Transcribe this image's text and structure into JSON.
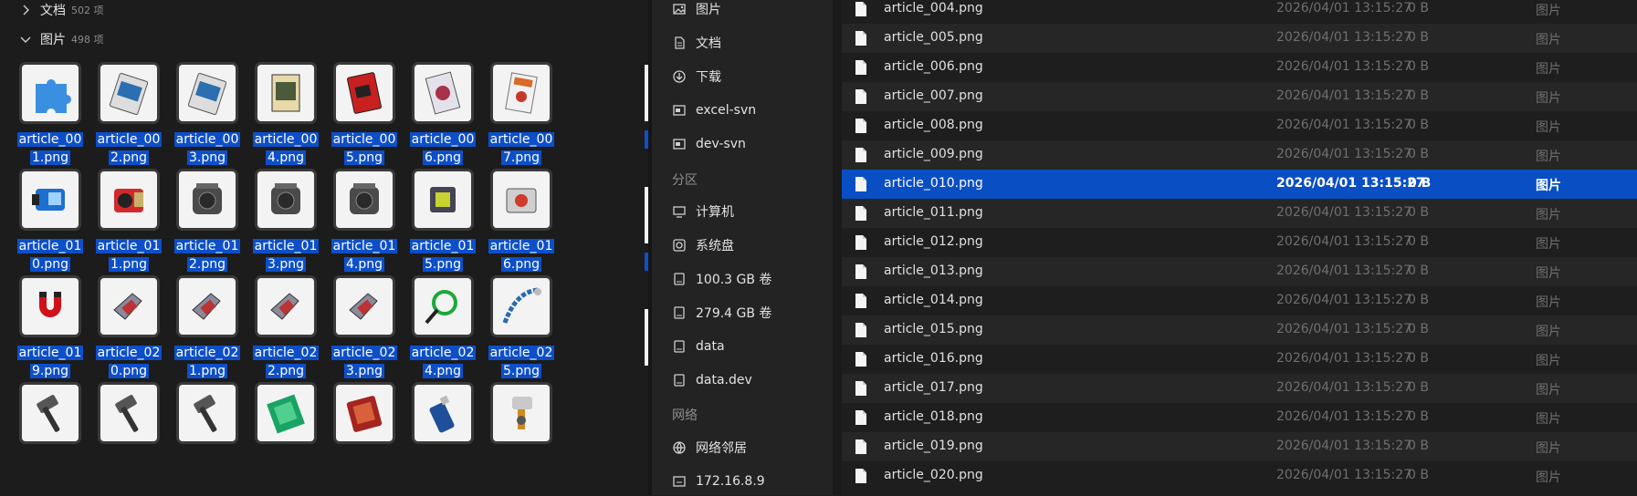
{
  "groups": {
    "documents": {
      "label": "文档",
      "count": "502 项"
    },
    "pictures": {
      "label": "图片",
      "count": "498 项"
    }
  },
  "tiles": [
    {
      "line1": "article_00",
      "line2": "1.png",
      "icon": "puzzle-piece-image-icon"
    },
    {
      "line1": "article_00",
      "line2": "2.png",
      "icon": "card-image-icon"
    },
    {
      "line1": "article_00",
      "line2": "3.png",
      "icon": "card-image-icon"
    },
    {
      "line1": "article_00",
      "line2": "4.png",
      "icon": "book-image-icon"
    },
    {
      "line1": "article_00",
      "line2": "5.png",
      "icon": "red-book-image-icon"
    },
    {
      "line1": "article_00",
      "line2": "6.png",
      "icon": "magazine-image-icon"
    },
    {
      "line1": "article_00",
      "line2": "7.png",
      "icon": "document-image-icon"
    },
    {
      "line1": "article_01",
      "line2": "0.png",
      "icon": "device-image-icon"
    },
    {
      "line1": "article_01",
      "line2": "1.png",
      "icon": "camera-image-icon"
    },
    {
      "line1": "article_01",
      "line2": "2.png",
      "icon": "engine-image-icon"
    },
    {
      "line1": "article_01",
      "line2": "3.png",
      "icon": "engine-image-icon"
    },
    {
      "line1": "article_01",
      "line2": "4.png",
      "icon": "engine-image-icon"
    },
    {
      "line1": "article_01",
      "line2": "5.png",
      "icon": "chip-image-icon"
    },
    {
      "line1": "article_01",
      "line2": "6.png",
      "icon": "machine-image-icon"
    },
    {
      "line1": "article_01",
      "line2": "9.png",
      "icon": "magnet-image-icon"
    },
    {
      "line1": "article_02",
      "line2": "0.png",
      "icon": "clamp-image-icon"
    },
    {
      "line1": "article_02",
      "line2": "1.png",
      "icon": "clamp-image-icon"
    },
    {
      "line1": "article_02",
      "line2": "2.png",
      "icon": "clamp-image-icon"
    },
    {
      "line1": "article_02",
      "line2": "3.png",
      "icon": "clamp-image-icon"
    },
    {
      "line1": "article_02",
      "line2": "4.png",
      "icon": "cable-image-icon"
    },
    {
      "line1": "article_02",
      "line2": "5.png",
      "icon": "chain-image-icon"
    },
    {
      "line1": "",
      "line2": "",
      "icon": "hammer-image-icon"
    },
    {
      "line1": "",
      "line2": "",
      "icon": "hammer-image-icon"
    },
    {
      "line1": "",
      "line2": "",
      "icon": "hammer-image-icon"
    },
    {
      "line1": "",
      "line2": "",
      "icon": "green-board-image-icon"
    },
    {
      "line1": "",
      "line2": "",
      "icon": "red-board-image-icon"
    },
    {
      "line1": "",
      "line2": "",
      "icon": "spray-can-image-icon"
    },
    {
      "line1": "",
      "line2": "",
      "icon": "spray-gun-image-icon"
    }
  ],
  "sidebar": {
    "items_top": [
      {
        "label": "图片",
        "icon": "image-icon"
      },
      {
        "label": "文档",
        "icon": "document-icon"
      },
      {
        "label": "下载",
        "icon": "download-icon"
      },
      {
        "label": "excel-svn",
        "icon": "folder-icon"
      },
      {
        "label": "dev-svn",
        "icon": "folder-icon"
      }
    ],
    "section_partition": "分区",
    "items_partition": [
      {
        "label": "计算机",
        "icon": "computer-icon"
      },
      {
        "label": "系统盘",
        "icon": "system-disk-icon"
      },
      {
        "label": "100.3 GB 卷",
        "icon": "drive-icon"
      },
      {
        "label": "279.4 GB 卷",
        "icon": "drive-icon"
      },
      {
        "label": "data",
        "icon": "drive-icon"
      },
      {
        "label": "data.dev",
        "icon": "drive-icon"
      }
    ],
    "section_network": "网络",
    "items_network": [
      {
        "label": "网络邻居",
        "icon": "network-icon"
      },
      {
        "label": "172.16.8.9",
        "icon": "network-folder-icon"
      }
    ]
  },
  "list": {
    "rows": [
      {
        "name": "article_004.png",
        "date": "2026/04/01 13:15:27",
        "size": "0 B",
        "type": "图片"
      },
      {
        "name": "article_005.png",
        "date": "2026/04/01 13:15:27",
        "size": "0 B",
        "type": "图片"
      },
      {
        "name": "article_006.png",
        "date": "2026/04/01 13:15:27",
        "size": "0 B",
        "type": "图片"
      },
      {
        "name": "article_007.png",
        "date": "2026/04/01 13:15:27",
        "size": "0 B",
        "type": "图片"
      },
      {
        "name": "article_008.png",
        "date": "2026/04/01 13:15:27",
        "size": "0 B",
        "type": "图片"
      },
      {
        "name": "article_009.png",
        "date": "2026/04/01 13:15:27",
        "size": "0 B",
        "type": "图片"
      },
      {
        "name": "article_010.png",
        "date": "2026/04/01 13:15:27",
        "size": "0 B",
        "type": "图片",
        "selected": true
      },
      {
        "name": "article_011.png",
        "date": "2026/04/01 13:15:27",
        "size": "0 B",
        "type": "图片"
      },
      {
        "name": "article_012.png",
        "date": "2026/04/01 13:15:27",
        "size": "0 B",
        "type": "图片"
      },
      {
        "name": "article_013.png",
        "date": "2026/04/01 13:15:27",
        "size": "0 B",
        "type": "图片"
      },
      {
        "name": "article_014.png",
        "date": "2026/04/01 13:15:27",
        "size": "0 B",
        "type": "图片"
      },
      {
        "name": "article_015.png",
        "date": "2026/04/01 13:15:27",
        "size": "0 B",
        "type": "图片"
      },
      {
        "name": "article_016.png",
        "date": "2026/04/01 13:15:27",
        "size": "0 B",
        "type": "图片"
      },
      {
        "name": "article_017.png",
        "date": "2026/04/01 13:15:27",
        "size": "0 B",
        "type": "图片"
      },
      {
        "name": "article_018.png",
        "date": "2026/04/01 13:15:27",
        "size": "0 B",
        "type": "图片"
      },
      {
        "name": "article_019.png",
        "date": "2026/04/01 13:15:27",
        "size": "0 B",
        "type": "图片"
      },
      {
        "name": "article_020.png",
        "date": "2026/04/01 13:15:27",
        "size": "0 B",
        "type": "图片"
      }
    ]
  },
  "colors": {
    "selection": "#0a4ec4",
    "label_highlight": "#0d4fc9",
    "background": "#1e1e1e"
  }
}
